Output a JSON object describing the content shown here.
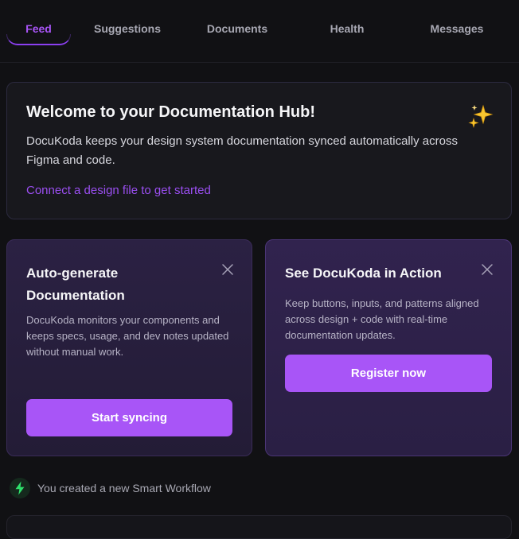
{
  "tabs": [
    {
      "label": "Feed",
      "active": true
    },
    {
      "label": "Suggestions",
      "active": false
    },
    {
      "label": "Documents",
      "active": false
    },
    {
      "label": "Health",
      "active": false
    },
    {
      "label": "Messages",
      "active": false
    }
  ],
  "welcome": {
    "title": "Welcome to your Documentation Hub!",
    "body": "DocuKoda keeps your design system documentation synced automatically across Figma and code.",
    "link": "Connect a design file to get started",
    "icon": "sparkle-icon"
  },
  "cards": [
    {
      "title": "Auto-generate Documentation",
      "body": "DocuKoda monitors your components and keeps specs, usage, and dev notes updated without manual work.",
      "button": "Start syncing",
      "icon": "close-icon"
    },
    {
      "title": "See DocuKoda in Action",
      "body": "Keep buttons, inputs, and patterns aligned across design + code with real-time documentation updates.",
      "button": "Register now",
      "icon": "close-icon"
    }
  ],
  "activity": {
    "icon": "lightning-bolt-icon",
    "text": "You created a new Smart Workflow"
  },
  "colors": {
    "background": "#111114",
    "accent": "#a855f7",
    "link": "#9b4ff2",
    "success": "#22c55e"
  }
}
